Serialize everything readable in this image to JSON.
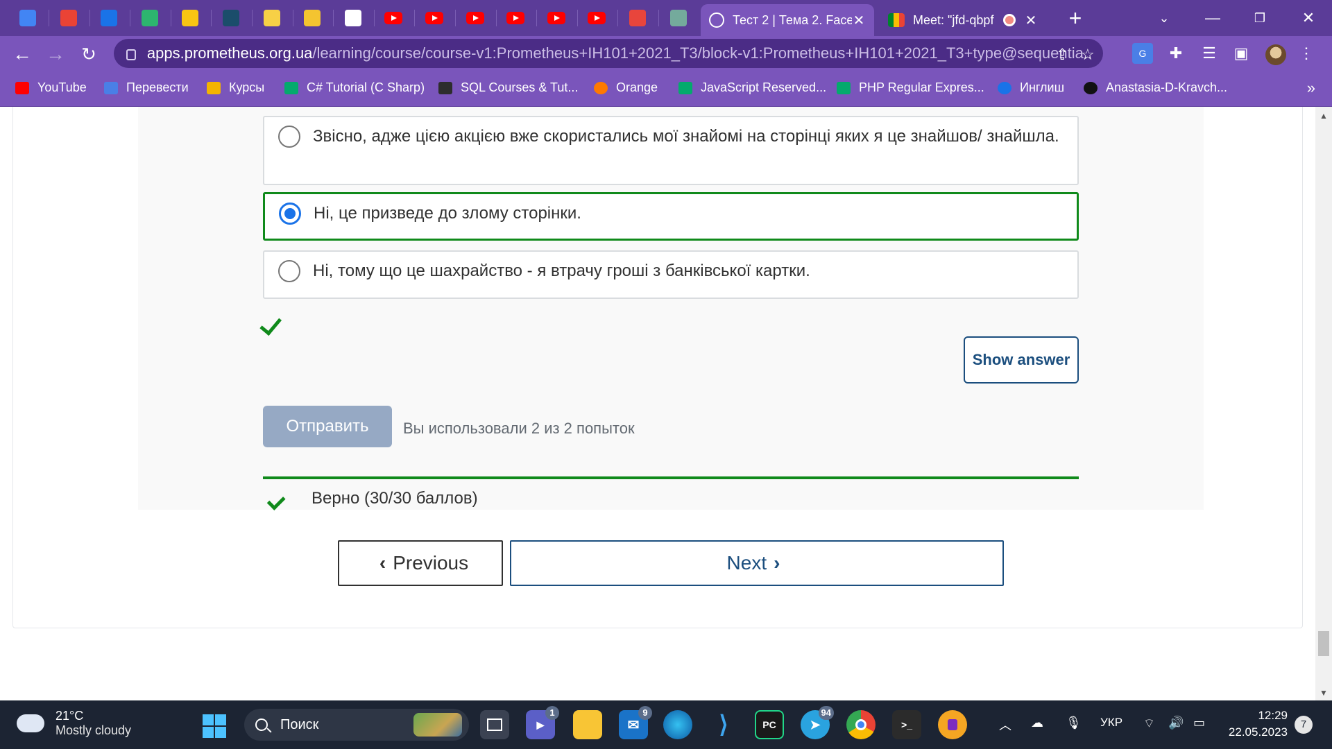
{
  "browser": {
    "pinned_tabs": [
      {
        "icon": "contacts-icon",
        "color": "#4285f4"
      },
      {
        "icon": "gmail-icon",
        "color": "#ea4335"
      },
      {
        "icon": "books-icon",
        "color": "#1a73e8"
      },
      {
        "icon": "tasks-check-icon",
        "color": "#2db56f"
      },
      {
        "icon": "bell-icon",
        "color": "#f9c513"
      },
      {
        "icon": "shield-icon",
        "color": "#1b4d6b"
      },
      {
        "icon": "bulb-icon",
        "color": "#f7d046"
      },
      {
        "icon": "m-logo-icon",
        "color": "#f4c430"
      },
      {
        "icon": "a-logo-icon",
        "color": "#ffffff"
      },
      {
        "icon": "youtube-icon",
        "color": "#ff0000"
      },
      {
        "icon": "youtube-icon",
        "color": "#ff0000"
      },
      {
        "icon": "youtube-icon",
        "color": "#ff0000"
      },
      {
        "icon": "youtube-icon",
        "color": "#ff0000"
      },
      {
        "icon": "youtube-icon",
        "color": "#ff0000"
      },
      {
        "icon": "youtube-icon",
        "color": "#ff0000"
      },
      {
        "icon": "openai-red-icon",
        "color": "#e8453c"
      },
      {
        "icon": "openai-icon",
        "color": "#74aa9c"
      }
    ],
    "active_tab_title": "Тест 2 | Тема 2. Face",
    "other_tab_title": "Meet: \"jfd-qbpf",
    "url_host": "apps.prometheus.org.ua",
    "url_path": "/learning/course/course-v1:Prometheus+IH101+2021_T3/block-v1:Prometheus+IH101+2021_T3+type@sequentia...",
    "bookmarks": [
      {
        "label": "YouTube",
        "icon": "youtube-icon"
      },
      {
        "label": "Перевести",
        "icon": "google-translate-icon"
      },
      {
        "label": "Курсы",
        "icon": "classroom-icon"
      },
      {
        "label": "C# Tutorial (C Sharp)",
        "icon": "w3schools-icon"
      },
      {
        "label": "SQL Courses & Tut...",
        "icon": "sql-icon"
      },
      {
        "label": "Orange",
        "icon": "orange-icon"
      },
      {
        "label": "JavaScript Reserved...",
        "icon": "w3schools-icon"
      },
      {
        "label": "PHP Regular Expres...",
        "icon": "w3schools-icon"
      },
      {
        "label": "Инглиш",
        "icon": "cloud-icon"
      },
      {
        "label": "Anastasia-D-Kravch...",
        "icon": "github-icon"
      }
    ],
    "bookmarks_more": "»"
  },
  "quiz": {
    "options": [
      {
        "text": "Звісно, адже цією акцією вже скористались мої знайомі на сторінці яких я це знайшов/ знайшла.",
        "selected": false
      },
      {
        "text": "Ні, це призведе до злому сторінки.",
        "selected": true
      },
      {
        "text": "Ні, тому що це шахрайство - я втрачу гроші з банківської картки.",
        "selected": false
      }
    ],
    "show_answer_label": "Show answer",
    "submit_label": "Отправить",
    "attempts_text": "Вы использовали 2 из 2 попыток",
    "result_text": "Верно (30/30 баллов)",
    "accent_color": "#108a1b"
  },
  "navigation": {
    "previous_label": "Previous",
    "next_label": "Next"
  },
  "taskbar": {
    "temperature": "21°C",
    "weather": "Mostly cloudy",
    "search_placeholder": "Поиск",
    "teams_badge": "1",
    "mail_badge": "9",
    "telegram_badge": "94",
    "language": "УКР",
    "time": "12:29",
    "date": "22.05.2023",
    "notifications": "7"
  }
}
